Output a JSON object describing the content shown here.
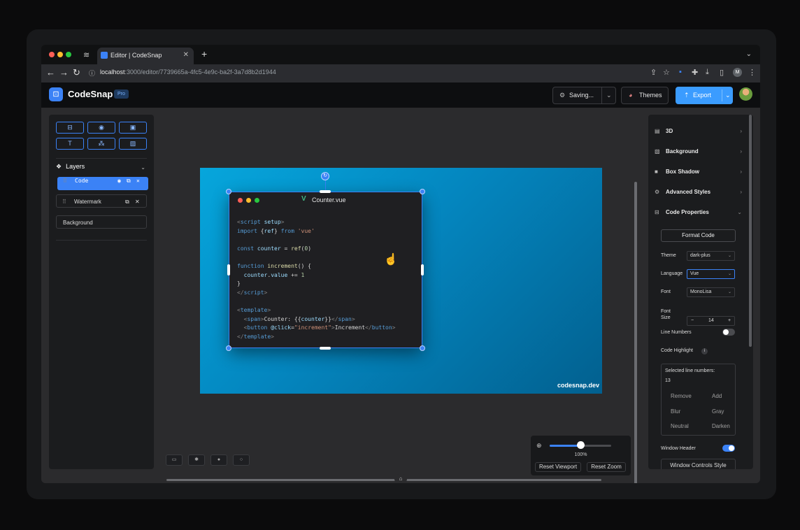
{
  "browser": {
    "tab_title": "Editor | CodeSnap",
    "url_host": "localhost",
    "url_path": ":3000/editor/7739665a-4fc5-4e9c-ba2f-3a7d8b2d1944",
    "profile_initial": "M"
  },
  "header": {
    "brand": "CodeSnap",
    "badge": "Pro",
    "saving_label": "Saving...",
    "themes_label": "Themes",
    "export_label": "Export"
  },
  "layers": {
    "title": "Layers",
    "items": [
      {
        "label": "Code"
      },
      {
        "label": "Watermark"
      },
      {
        "label": "Background"
      }
    ]
  },
  "canvas": {
    "filename": "Counter.vue",
    "watermark": "codesnap.dev"
  },
  "zoom": {
    "value_label": "100%",
    "level": 0.5,
    "reset_viewport": "Reset Viewport",
    "reset_zoom": "Reset Zoom"
  },
  "properties": {
    "sections": [
      {
        "label": "3D"
      },
      {
        "label": "Background"
      },
      {
        "label": "Box Shadow"
      },
      {
        "label": "Advanced Styles"
      },
      {
        "label": "Code Properties"
      }
    ],
    "format_code": "Format Code",
    "theme_label": "Theme",
    "theme_value": "dark-plus",
    "language_label": "Language",
    "language_value": "Vue",
    "font_label": "Font",
    "font_value": "MonoLisa",
    "font_size_label_1": "Font",
    "font_size_label_2": "Size",
    "font_size_value": "14",
    "line_numbers_label": "Line Numbers",
    "line_numbers_on": false,
    "code_highlight_label": "Code Highlight",
    "selected_lines_label": "Selected line numbers:",
    "selected_lines_value": "13",
    "hl_buttons": [
      "Remove",
      "Add",
      "Blur",
      "Gray",
      "Neutral",
      "Darken"
    ],
    "window_header_label": "Window Header",
    "window_header_on": true,
    "window_controls_label": "Window Controls Style"
  },
  "colors": {
    "accent": "#3b82f6",
    "export": "#3b9cff",
    "canvas_gradient_start": "#06a6dc",
    "canvas_gradient_end": "#02608f"
  }
}
